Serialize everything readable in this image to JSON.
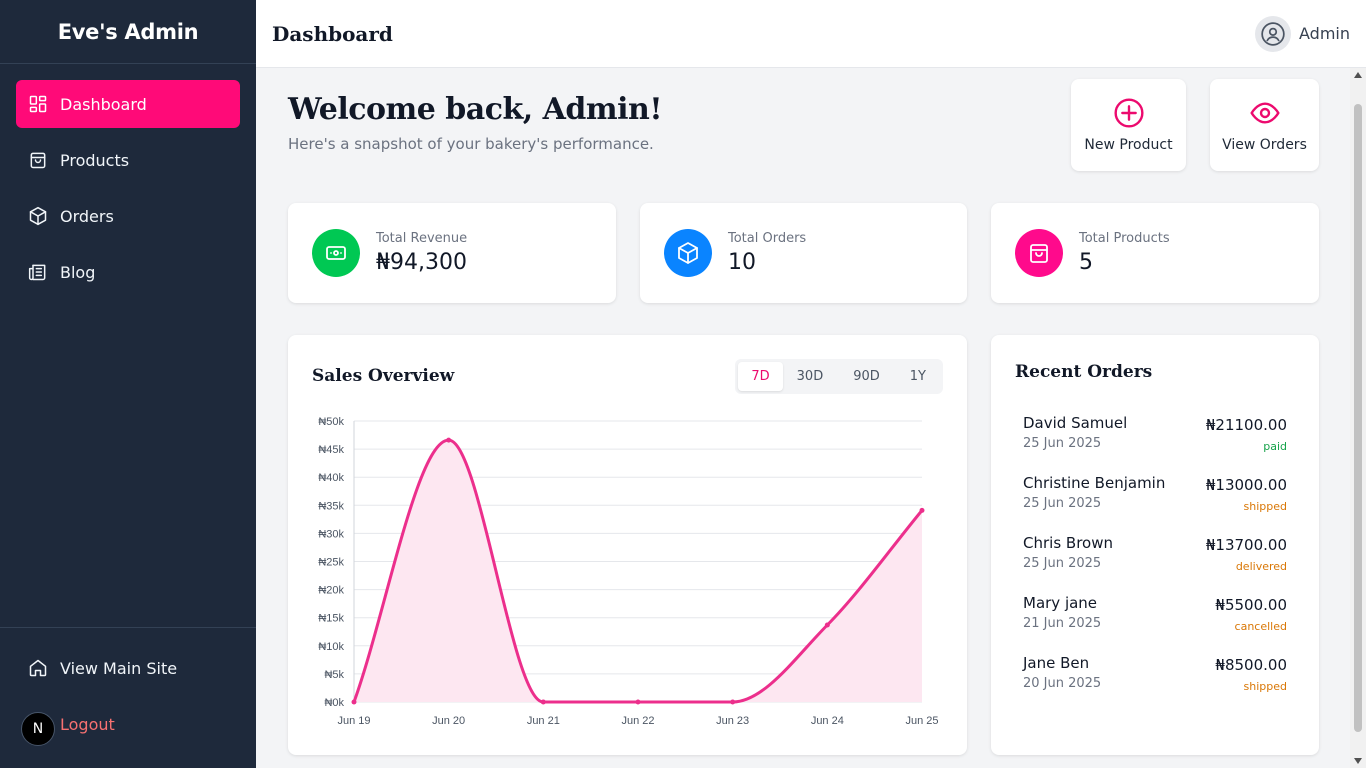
{
  "sidebar": {
    "brand": "Eve's Admin",
    "items": [
      {
        "label": "Dashboard",
        "icon": "dashboard-icon",
        "active": true
      },
      {
        "label": "Products",
        "icon": "shopping-bag-icon"
      },
      {
        "label": "Orders",
        "icon": "package-icon"
      },
      {
        "label": "Blog",
        "icon": "newspaper-icon"
      }
    ],
    "view_main_site": "View Main Site",
    "logout": "Logout",
    "badge": "N"
  },
  "topbar": {
    "title": "Dashboard",
    "user": "Admin"
  },
  "welcome": {
    "heading": "Welcome back, Admin!",
    "subtitle": "Here's a snapshot of your bakery's performance."
  },
  "quick_actions": {
    "new_product": "New Product",
    "view_orders": "View Orders"
  },
  "stats": [
    {
      "label": "Total Revenue",
      "value": "₦94,300",
      "color": "#00c853"
    },
    {
      "label": "Total Orders",
      "value": "10",
      "color": "#0a84ff"
    },
    {
      "label": "Total Products",
      "value": "5",
      "color": "#ff0a8c"
    }
  ],
  "sales": {
    "title": "Sales Overview",
    "ranges": [
      "7D",
      "30D",
      "90D",
      "1Y"
    ],
    "active_range": "7D"
  },
  "chart_data": {
    "type": "area",
    "x": [
      "Jun 19",
      "Jun 20",
      "Jun 21",
      "Jun 22",
      "Jun 23",
      "Jun 24",
      "Jun 25"
    ],
    "series": [
      {
        "values": [
          0,
          46600,
          0,
          0,
          0,
          13700,
          34100
        ]
      }
    ],
    "yticks": [
      "₦0k",
      "₦5k",
      "₦10k",
      "₦15k",
      "₦20k",
      "₦25k",
      "₦30k",
      "₦35k",
      "₦40k",
      "₦45k",
      "₦50k"
    ],
    "ylim": [
      0,
      50000
    ],
    "grid": true,
    "line_color": "#ec2f8c",
    "fill_color": "#fde7f1"
  },
  "recent": {
    "title": "Recent Orders",
    "orders": [
      {
        "name": "David Samuel",
        "date": "25 Jun 2025",
        "amount": "₦21100.00",
        "status": "paid",
        "status_color": "#16a34a"
      },
      {
        "name": "Christine Benjamin",
        "date": "25 Jun 2025",
        "amount": "₦13000.00",
        "status": "shipped",
        "status_color": "#d97706"
      },
      {
        "name": "Chris Brown",
        "date": "25 Jun 2025",
        "amount": "₦13700.00",
        "status": "delivered",
        "status_color": "#d97706"
      },
      {
        "name": "Mary jane",
        "date": "21 Jun 2025",
        "amount": "₦5500.00",
        "status": "cancelled",
        "status_color": "#d97706"
      },
      {
        "name": "Jane Ben",
        "date": "20 Jun 2025",
        "amount": "₦8500.00",
        "status": "shipped",
        "status_color": "#d97706"
      }
    ]
  }
}
